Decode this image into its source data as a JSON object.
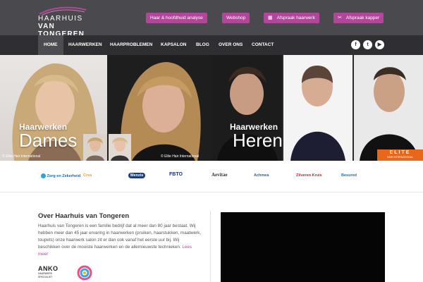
{
  "header": {
    "logo_line1": "HAARHUIS",
    "logo_line2": "VAN TONGEREN",
    "buttons": [
      {
        "label": "Haar & hoofdhuid analyse",
        "icon": ""
      },
      {
        "label": "Webshop",
        "icon": ""
      },
      {
        "label": "Afspraak haarwerk",
        "icon": "calendar-icon"
      },
      {
        "label": "Afspraak kapper",
        "icon": "scissors-icon"
      }
    ],
    "accent": "#b0479a"
  },
  "nav": {
    "items": [
      "HOME",
      "HAARWERKEN",
      "HAARPROBLEMEN",
      "KAPSALON",
      "BLOG",
      "OVER ONS",
      "CONTACT"
    ],
    "active": "HOME",
    "social": [
      "facebook-icon",
      "twitter-icon",
      "youtube-icon"
    ]
  },
  "hero": {
    "left_small": "Haarwerken",
    "left_big": "Dames",
    "right_small": "Haarwerken",
    "right_big": "Heren",
    "credit_left": "© Elite Hair International",
    "credit_mid": "© Elite Hair International",
    "badge_top": "ELITE",
    "badge_bottom": "HAIR INTERNATIONAL"
  },
  "partners": [
    "Zorg en Zekerheid",
    "Crea",
    "Menzis",
    "FBTO",
    "Aevitae",
    "Achmea",
    "Zilveren Kruis",
    "Besured"
  ],
  "about": {
    "title": "Over Haarhuis van Tongeren",
    "text": "Haarhuis van Tongeren is een familie bedrijf dat al meer dan 80 jaar bestaat. Wij hebben meer dan 45 jaar ervaring in haarwerken (pruiken, haarstukken, maatwerk, toupets) onze haarwerk salon zit er dan ook vanaf het eerste uur bij. Wij beschikken over de mooiste haarwerken en de allernieuwste technieken.",
    "read_more": "Lees meer",
    "anko_label": "ANKO",
    "anko_sub": "HAARWERK SPECIALIST"
  }
}
